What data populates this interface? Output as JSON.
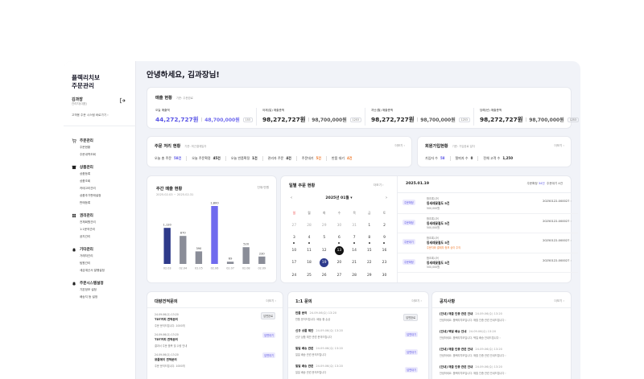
{
  "sidebar": {
    "brand_line1": "플렉리치보",
    "brand_line2": "주문관리",
    "user_name": "김과장",
    "user_role": "관리자(대표)",
    "profile_link": "고객용 주문 시스템 바로가기",
    "groups": [
      {
        "title": "주문관리",
        "icon": "cart-icon",
        "items": [
          "주문현황",
          "주문내역조회"
        ]
      },
      {
        "title": "상품관리",
        "icon": "box-icon",
        "items": [
          "상품등록",
          "상품조회",
          "카테고리관리",
          "상품추가판매설정",
          "판매등록"
        ]
      },
      {
        "title": "권리관리",
        "icon": "grid-icon",
        "items": [
          "전체회원관리",
          "1:1문의관리",
          "공지관리"
        ]
      },
      {
        "title": "기타관리",
        "icon": "bell-icon",
        "items": [
          "거래처관리",
          "팀원관리",
          "세금계산서 발행설정"
        ]
      },
      {
        "title": "주문시스템설정",
        "icon": "bell-icon",
        "items": [
          "기본정보 설정",
          "배송지 등 설정"
        ]
      }
    ]
  },
  "greeting": "안녕하세요, 김과장님!",
  "sales": {
    "title": "매출 현황",
    "note": "기준: 주문완료",
    "columns": [
      {
        "label": "오늘 매출액",
        "main": "44,272,727원",
        "sub": "48,700,000원",
        "badge": "153",
        "accent": true
      },
      {
        "label": "어제(일) 매출총액",
        "main": "98,272,727원",
        "sub": "98,700,000원",
        "badge": "1253",
        "accent": false
      },
      {
        "label": "지난(월) 매출총액",
        "main": "98,272,727원",
        "sub": "98,700,000원",
        "badge": "1253",
        "accent": false
      },
      {
        "label": "당해(년) 매출총액",
        "main": "98,272,727원",
        "sub": "98,700,000원",
        "badge": "1253",
        "accent": false
      }
    ]
  },
  "order_status": {
    "title": "주문 처리 현황",
    "note": "기준: 최근결제일자",
    "more": "더보기",
    "stats": [
      {
        "label": "오늘 총 주문",
        "value": "58건",
        "color": "blue"
      },
      {
        "label": "오늘 주문확정",
        "value": "45건",
        "color": ""
      },
      {
        "label": "오늘 반품확정",
        "value": "1건",
        "color": ""
      },
      {
        "label": "관리자 주문",
        "value": "4건",
        "color": ""
      },
      {
        "label": "주문대기",
        "value": "5건",
        "color": "orange"
      },
      {
        "label": "반품 대기",
        "value": "4건",
        "color": "orange"
      }
    ]
  },
  "members": {
    "title": "회원가입현황",
    "note": "기준: 가입완료 일자",
    "more": "더보기",
    "stats": [
      {
        "label": "가입자 수",
        "value": "58",
        "color": "blue"
      },
      {
        "label": "탈퇴자 수",
        "value": "0",
        "color": ""
      },
      {
        "label": "전체 고객 수",
        "value": "1,250",
        "color": ""
      }
    ]
  },
  "weekly": {
    "title": "주간 매출 현황",
    "range": "2025.02.03 ~ 2025.02.31",
    "unit": "단위:만원"
  },
  "chart_data": {
    "type": "bar",
    "title": "주간 매출 현황",
    "categories": [
      "02.03",
      "02.04",
      "02.05",
      "02.06",
      "02.07",
      "02.08",
      "02.09"
    ],
    "values": [
      1120,
      870,
      390,
      1800,
      69,
      520,
      230
    ],
    "labels": [
      "1,120",
      "870",
      "390",
      "1,800",
      "69",
      "520",
      "230"
    ],
    "highlight_index": [
      0,
      3
    ],
    "colors": {
      "highlight": "#2e3a8a",
      "accent": "#6f6aee",
      "normal": "#8a8d98"
    },
    "ylim": [
      0,
      1800
    ],
    "grid": false,
    "legend": "none"
  },
  "calendar": {
    "title": "일별 주문 현황",
    "more": "더보기",
    "month": "2025년 01월",
    "dow": [
      "일",
      "월",
      "화",
      "수",
      "목",
      "금",
      "토"
    ],
    "weeks": [
      [
        {
          "d": "27",
          "m": 1
        },
        {
          "d": "28",
          "m": 1
        },
        {
          "d": "29",
          "m": 1
        },
        {
          "d": "30",
          "m": 1
        },
        {
          "d": "31",
          "m": 1
        },
        {
          "d": "1"
        },
        {
          "d": "2"
        }
      ],
      [
        {
          "d": "3",
          "dot": 1
        },
        {
          "d": "4",
          "dot": 1
        },
        {
          "d": "5"
        },
        {
          "d": "6",
          "dot": 1
        },
        {
          "d": "7",
          "dot": 1
        },
        {
          "d": "8",
          "dot": 1
        },
        {
          "d": "9",
          "dot": 1
        }
      ],
      [
        {
          "d": "10"
        },
        {
          "d": "11"
        },
        {
          "d": "12"
        },
        {
          "d": "13",
          "today": 1
        },
        {
          "d": "14"
        },
        {
          "d": "15"
        },
        {
          "d": "16"
        }
      ],
      [
        {
          "d": "17"
        },
        {
          "d": "18"
        },
        {
          "d": "19",
          "sel": 1
        },
        {
          "d": "20"
        },
        {
          "d": "21"
        },
        {
          "d": "22"
        },
        {
          "d": "23"
        }
      ],
      [
        {
          "d": "24"
        },
        {
          "d": "25"
        },
        {
          "d": "26"
        },
        {
          "d": "27"
        },
        {
          "d": "28"
        },
        {
          "d": "29"
        },
        {
          "d": "30"
        }
      ]
    ]
  },
  "orders_panel": {
    "date": "2025.01.19",
    "summary_label": "주문확정",
    "summary_count": "34건",
    "wait_label": "주문대기",
    "wait_count": "4건",
    "items": [
      {
        "tag": "주문확정",
        "user": "함초록니어",
        "product": "등세레꽃절도 5건",
        "extra": "500,000원",
        "warn": false,
        "no": "20250122-000027"
      },
      {
        "tag": "주문확정",
        "user": "함초록니어",
        "product": "등세레꽃절도 5건",
        "extra": "500,000원",
        "warn": false,
        "no": "20250122-000027"
      },
      {
        "tag": "주문대기",
        "user": "함초록니어",
        "product": "등세레꽃절도 5건",
        "extra": "주문자와 결제자 정보 상이 주의",
        "warn": true,
        "no": "20250122-000027"
      },
      {
        "tag": "주문확정",
        "user": "함초록니어",
        "product": "등세레꽃절도 5건",
        "extra": "500,000원",
        "warn": false,
        "no": "20250122-000027"
      }
    ]
  },
  "consult": {
    "title": "대량견적문의",
    "more": "더보기",
    "items": [
      {
        "date": "24.09.06(수) 13:20",
        "title": "TDT커피 견적문의",
        "desc": "주문 문의드립니다. 1000개",
        "badge": "답변완료",
        "state": "done"
      },
      {
        "date": "24.09.06(수) 13:20",
        "title": "TDT커피 견적문의",
        "desc": "결과서 주문 품목 및 수량 안내",
        "badge": "답변대기",
        "state": "wait"
      },
      {
        "date": "24.09.06(수) 13:20",
        "title": "용품에이 견적문의",
        "desc": "주문 문의드립니다. 1000개",
        "badge": "답변대기",
        "state": "wait"
      }
    ]
  },
  "inquiry": {
    "title": "1:1 문의",
    "more": "더보기",
    "items": [
      {
        "title": "반품 문의",
        "date": "24.09.06(수) 13:20",
        "desc": "반품 문의드립니다. 배송 중 손상",
        "badge": "답변완료",
        "state": "done"
      },
      {
        "title": "신규 상품 제안",
        "date": "24.09.06(수) 13:20",
        "desc": "신규 상품 제안 관련 문의드립니다",
        "badge": "답변대기",
        "state": "wait"
      },
      {
        "title": "일일 배송 관련",
        "date": "24.09.06(수) 13:20",
        "desc": "일일 배송 관련 문의드립니다",
        "badge": "답변대기",
        "state": "wait"
      },
      {
        "title": "일일 배송 관련",
        "date": "24.09.06(수) 13:20",
        "desc": "일일 배송 관련 문의드립니다",
        "badge": "답변대기",
        "state": "wait"
      }
    ]
  },
  "notice": {
    "title": "공지사항",
    "more": "더보기",
    "items": [
      {
        "title": "[안내] 매출 인증 관련 안내",
        "date": "24.09.06(수) 13:20",
        "desc": "안녕하세요. 플렉리치보입니다. 매출 인증 관련 안내드립니다"
      },
      {
        "title": "[안내] 택일 배송 안내",
        "date": "24.09.06(수) 13:20",
        "desc": "안녕하세요. 플렉리치보입니다. 택일 배송 안내드립니다"
      },
      {
        "title": "[안내] 매출 인증 관련 안내",
        "date": "24.09.06(수) 13:20",
        "desc": "안녕하세요. 플렉리치보입니다. 매출 인증 관련 안내드립니다"
      },
      {
        "title": "[안내] 매출 인증 관련 안내",
        "date": "24.09.06(수) 13:20",
        "desc": "안녕하세요. 플렉리치보입니다. 매출 인증 관련 안내드립니다"
      }
    ]
  }
}
